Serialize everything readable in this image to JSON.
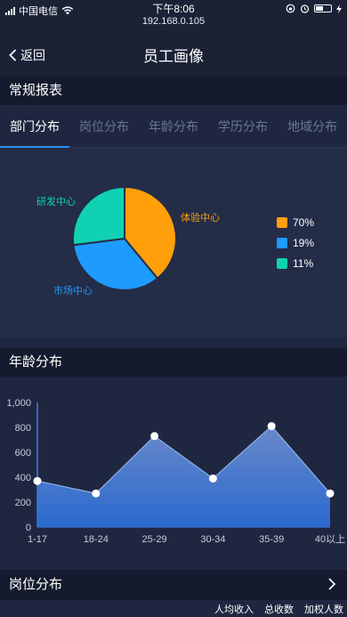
{
  "status_bar": {
    "carrier": "中国电信",
    "time": "下午8:06",
    "url": "192.168.0.105"
  },
  "nav": {
    "back_label": "返回",
    "title": "员工画像"
  },
  "section_regular": "常规报表",
  "tabs": [
    {
      "label": "部门分布",
      "active": true
    },
    {
      "label": "岗位分布",
      "active": false
    },
    {
      "label": "年龄分布",
      "active": false
    },
    {
      "label": "学历分布",
      "active": false
    },
    {
      "label": "地域分布",
      "active": false
    }
  ],
  "dept_pie": {
    "slices": [
      {
        "label": "体验中心",
        "value": 70,
        "color": "#ff9f0a"
      },
      {
        "label": "市场中心",
        "value": 19,
        "color": "#1e9bff"
      },
      {
        "label": "研发中心",
        "value": 11,
        "color": "#10d2b2"
      }
    ],
    "legend": [
      {
        "text": "70%",
        "color": "#ff9f0a"
      },
      {
        "text": "19%",
        "color": "#1e9bff"
      },
      {
        "text": "11%",
        "color": "#10d2b2"
      }
    ]
  },
  "section_age": "年龄分布",
  "chart_data": {
    "type": "area",
    "categories": [
      "1-17",
      "18-24",
      "25-29",
      "30-34",
      "35-39",
      "40以上"
    ],
    "values": [
      370,
      270,
      730,
      390,
      810,
      270
    ],
    "ylim": [
      0,
      1000
    ],
    "yticks": [
      "1,000",
      "800",
      "600",
      "400",
      "200",
      "0"
    ],
    "xlabel": "",
    "ylabel": "",
    "color": "#4a8fe0"
  },
  "section_position": "岗位分布",
  "position_columns": [
    "人均收入",
    "总收数",
    "加权人数"
  ]
}
